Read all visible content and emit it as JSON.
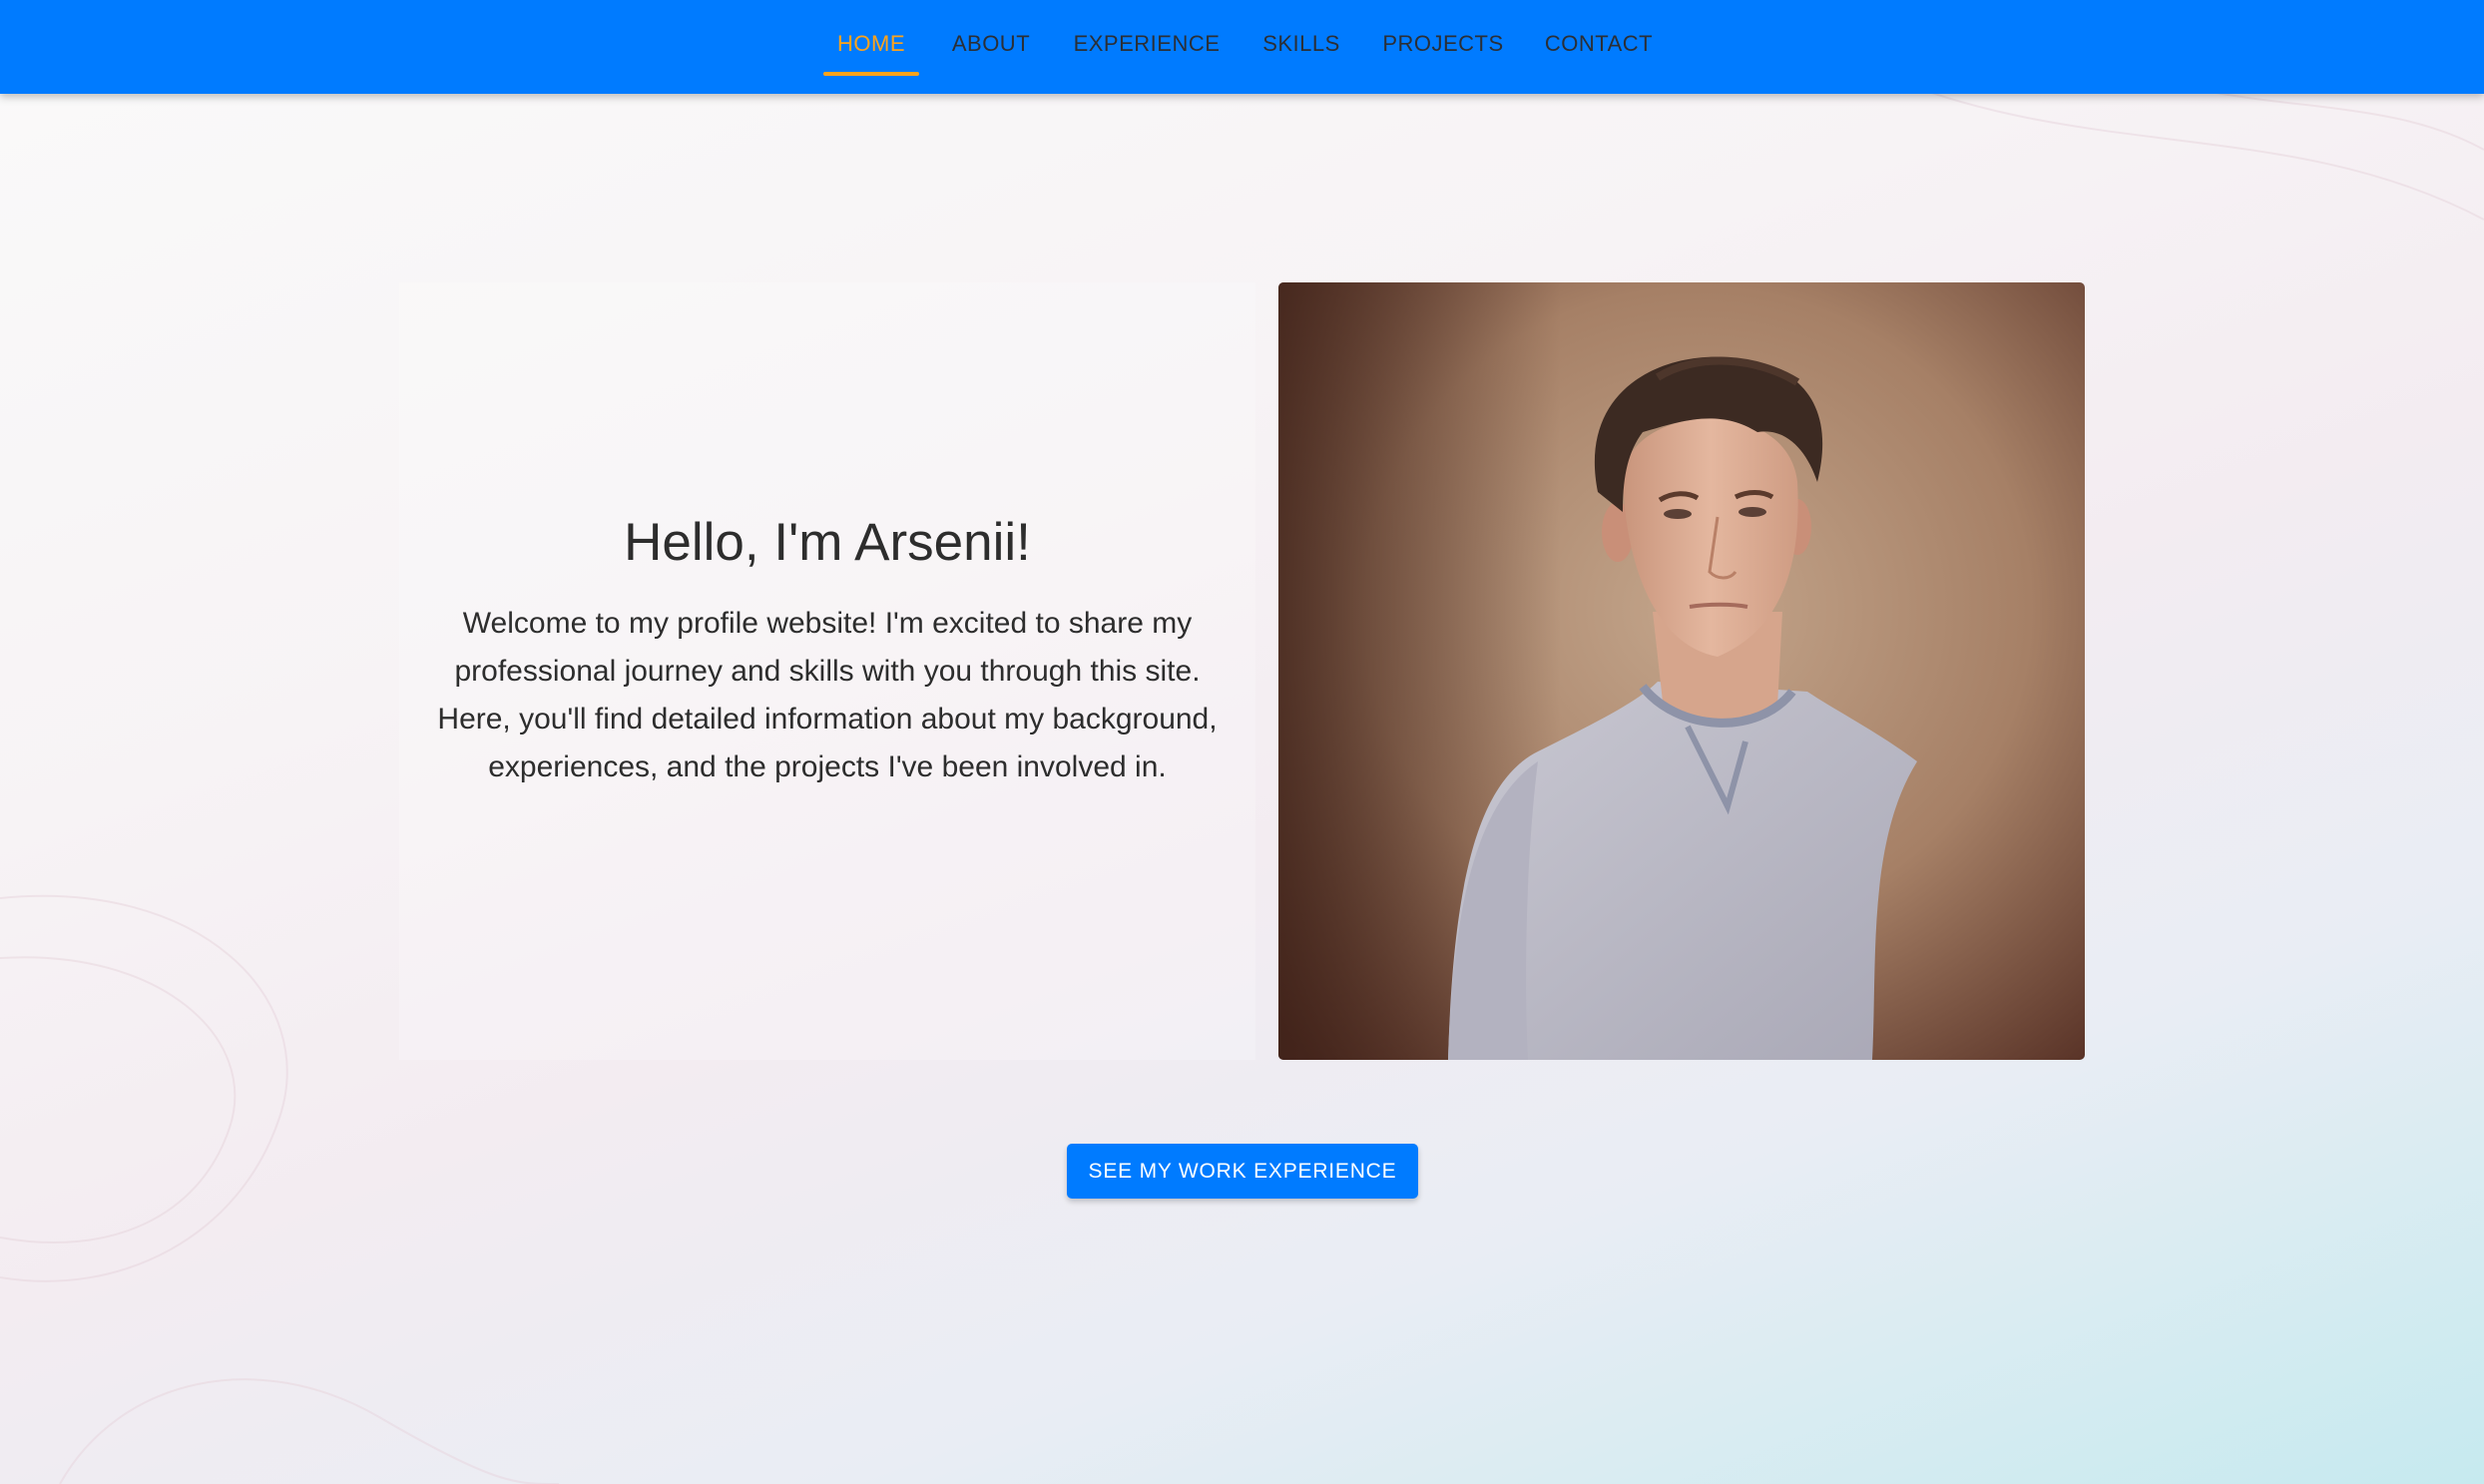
{
  "nav": {
    "items": [
      {
        "label": "HOME",
        "active": true
      },
      {
        "label": "ABOUT",
        "active": false
      },
      {
        "label": "EXPERIENCE",
        "active": false
      },
      {
        "label": "SKILLS",
        "active": false
      },
      {
        "label": "PROJECTS",
        "active": false
      },
      {
        "label": "CONTACT",
        "active": false
      }
    ]
  },
  "hero": {
    "greeting": "Hello, I'm Arsenii!",
    "intro": "Welcome to my profile website! I'm excited to share my professional journey and skills with you through this site. Here, you'll find detailed information about my background, experiences, and the projects I've been involved in.",
    "photo_icon": "profile-portrait-image"
  },
  "cta": {
    "label": "SEE MY WORK EXPERIENCE"
  },
  "colors": {
    "navbar": "#007bff",
    "active_accent": "#ffa31a",
    "button": "#007bff",
    "text": "#2d2d2d"
  }
}
